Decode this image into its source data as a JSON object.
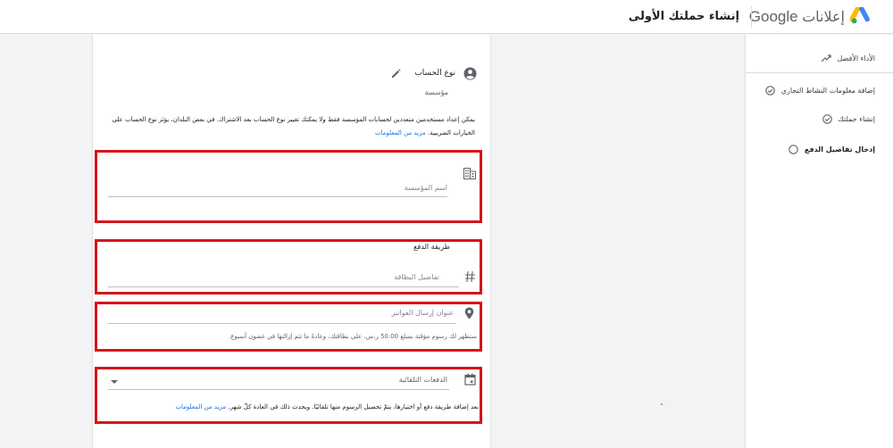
{
  "header": {
    "brand_google": "Google",
    "brand_ads": "إعلانات",
    "page_title": "إنشاء حملتك الأولى"
  },
  "stepper": {
    "items": [
      {
        "label": "الأداء الأفضل",
        "icon": "trend-icon",
        "state": "link"
      },
      {
        "label": "إضافة معلومات النشاط التجاري",
        "icon": "check-circle-icon",
        "state": "done"
      },
      {
        "label": "إنشاء حملتك",
        "icon": "check-circle-icon",
        "state": "done"
      },
      {
        "label": "إدخال تفاصيل الدفع",
        "icon": "circle-icon",
        "state": "current"
      }
    ]
  },
  "account": {
    "title": "نوع الحساب",
    "value": "مؤسسة",
    "note": "يمكن إعداد مستخدمين متعددين لحسابات المؤسسة فقط ولا يمكنك تغيير نوع الحساب بعد الاشتراك. في بعض البلدان، يؤثر نوع الحساب على الخيارات الضريبية.",
    "note_link": "مزيد من المعلومات"
  },
  "organization": {
    "placeholder": "اسم المؤسسة"
  },
  "payment": {
    "section_label": "طريقة الدفع",
    "card_placeholder": "تفاصيل البطاقة"
  },
  "billing": {
    "address_placeholder": "عنوان إرسال الفواتير",
    "helper": "ستظهر لك رسوم مؤقتة بمبلغ 50.00 ر.س. على بطاقتك، وعادةً ما تتم إزالتها في غضون أسبوع."
  },
  "payments_setting": {
    "selected_value": "الدفعات التلقائية",
    "helper": "بعد إضافة طريقة دفع أو اختيارها، يتمّ تحصيل الرسوم منها تلقائيًا. ويحدث ذلك في العادة كلّ شهر.",
    "helper_link": "مزيد من المعلومات"
  },
  "colors": {
    "highlight_border": "#d6141b",
    "link": "#1a73e8"
  }
}
